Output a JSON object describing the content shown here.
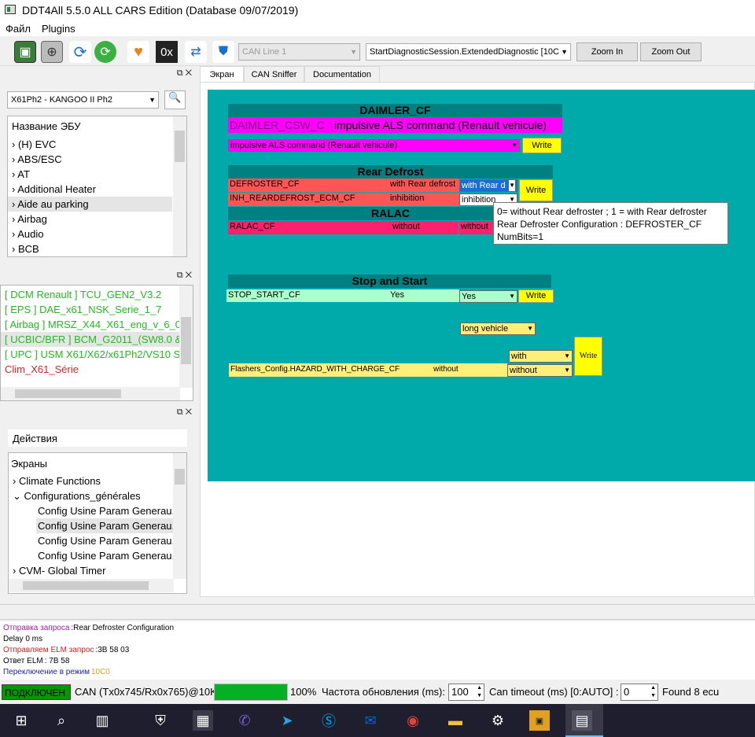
{
  "window": {
    "title": "DDT4All 5.5.0 ALL CARS Edition (Database 09/07/2019)"
  },
  "menu": {
    "file": "Файл",
    "plugins": "Plugins"
  },
  "toolbar": {
    "bus_label": "0x",
    "can_line": "CAN Line 1",
    "session": "StartDiagnosticSession.ExtendedDiagnostic [10C",
    "zoom_in": "Zoom In",
    "zoom_out": "Zoom Out"
  },
  "ecu_panel": {
    "vehicle": "X61Ph2 - KANGOO II Ph2",
    "header": "Название ЭБУ",
    "items": [
      "(H) EVC",
      "ABS/ESC",
      "AT",
      "Additional Heater",
      "Aide au parking",
      "Airbag",
      "Audio",
      "BCB"
    ]
  },
  "found_panel": {
    "items": [
      {
        "text": "[ DCM Renault ] TCU_GEN2_V3.2",
        "color": "#22bb22"
      },
      {
        "text": "[ EPS ] DAE_x61_NSK_Serie_1_7",
        "color": "#22bb22"
      },
      {
        "text": "[ Airbag ] MRSZ_X44_X61_eng_v_6_0",
        "color": "#22bb22"
      },
      {
        "text": "[ UCBIC/BFR ] BCM_G2011_(SW8.0 &",
        "color": "#22bb22"
      },
      {
        "text": "[ UPC ] USM X61/X62/x61Ph2/VS10 S",
        "color": "#22bb22"
      },
      {
        "text": "Clim_X61_Série",
        "color": "#dd2222"
      }
    ]
  },
  "actions_panel": {
    "header": "Действия",
    "screens": "Экраны",
    "items": [
      "Climate Functions",
      "Configurations_générales",
      "Config Usine Param Generau.",
      "Config Usine Param Generau.",
      "Config Usine Param Generau.",
      "Config Usine Param Generau.",
      "CVM- Global Timer"
    ]
  },
  "tabs": [
    "Экран",
    "CAN Sniffer",
    "Documentation"
  ],
  "screen": {
    "daimler": {
      "title": "DAIMLER_CF",
      "param": "DAIMLER_CSW_C",
      "value": "impulsive ALS command (Renault vehicule)",
      "select": "impulsive ALS command (Renault vehicule)",
      "write": "Write"
    },
    "rear_defrost": {
      "title": "Rear Defrost",
      "rows": [
        {
          "name": "DEFROSTER_CF",
          "value": "with Rear defrost",
          "select": "with Rear d"
        },
        {
          "name": "INH_REARDEFROST_ECM_CF",
          "value": "inhibition",
          "select": "inhibition"
        }
      ],
      "write": "Write"
    },
    "ralac": {
      "title": "RALAC",
      "name": "RALAC_CF",
      "value": "without",
      "select": "without"
    },
    "stop_start": {
      "title": "Stop and Start",
      "name": "STOP_START_CF",
      "value": "Yes",
      "select": "Yes",
      "write": "Write"
    },
    "vehicle_select": "long vehicle",
    "flashers": {
      "name": "Flashers_Config.HAZARD_WITH_CHARGE_CF",
      "value": "without",
      "select_top": "with",
      "select": "without",
      "write": "Write"
    },
    "tooltip": [
      "0= without Rear defroster ; 1 = with Rear defroster",
      "Rear Defroster Configuration : DEFROSTER_CF",
      "NumBits=1"
    ]
  },
  "log": [
    {
      "label": "Отправка запроса",
      "text": ":Rear Defroster Configuration",
      "color": "#a020a0"
    },
    {
      "label": "Delay 0 ms",
      "text": "",
      "color": "#000000"
    },
    {
      "label": "Отправляем ELM запрос",
      "text": ":3B 58 03",
      "color": "#cc2222"
    },
    {
      "label": "Ответ ELM",
      "text": ": 7B 58",
      "color": "#000000"
    },
    {
      "label": "Переключение в режим",
      "text": "10C0",
      "color": "#2222aa"
    }
  ],
  "status": {
    "connected": "ПОДКЛЮЧЕН",
    "can": "CAN (Tx0x745/Rx0x765)@10K",
    "progress": "100%",
    "progress_value": 1.0,
    "refresh_label": "Частота обновления (ms):",
    "refresh": "100",
    "timeout_label": "Can timeout (ms) [0:AUTO] :",
    "timeout": "0",
    "found": "Found 8 ecu"
  }
}
